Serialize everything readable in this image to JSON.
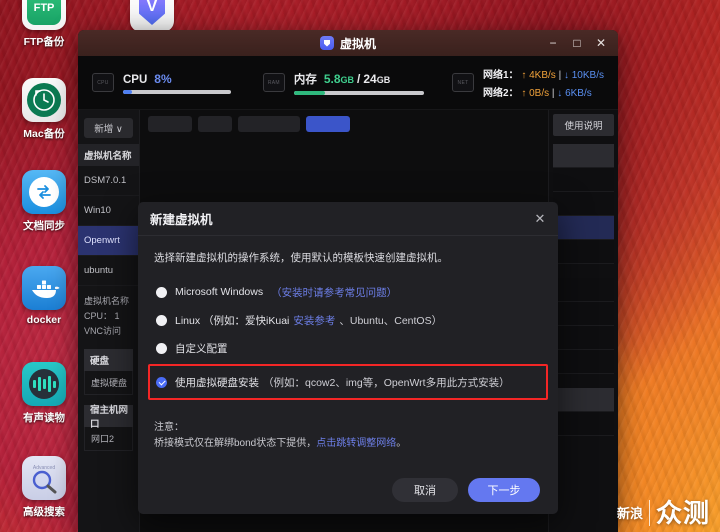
{
  "desktop": {
    "icons": [
      {
        "name": "ftp-backup",
        "label": "FTP备份",
        "glyph": "FTP",
        "style": "ic-ftp"
      },
      {
        "name": "mac-backup",
        "label": "Mac备份",
        "glyph": "clock",
        "style": "ic-tm"
      },
      {
        "name": "doc-sync",
        "label": "文档同步",
        "glyph": "sync",
        "style": "ic-sync"
      },
      {
        "name": "docker",
        "label": "docker",
        "glyph": "whale",
        "style": "ic-docker"
      },
      {
        "name": "audiobook",
        "label": "有声读物",
        "glyph": "waveform",
        "style": "ic-audio"
      },
      {
        "name": "advanced-search",
        "label": "高级搜索",
        "glyph": "magnifier",
        "style": "ic-search"
      },
      {
        "name": "virtual-machine",
        "label": "",
        "glyph": "V",
        "style": "ic-v"
      }
    ],
    "watermark": {
      "small": "新浪",
      "big": "众测"
    }
  },
  "window": {
    "title": "虚拟机",
    "logo_icon": "shield-icon",
    "controls": {
      "minimize": "−",
      "maximize": "□",
      "close": "✕"
    }
  },
  "stats": {
    "cpu": {
      "label": "CPU",
      "value": "8%",
      "percent": 8,
      "icon": "cpu-icon",
      "icon_text": "CPU"
    },
    "memory": {
      "label": "内存",
      "used": "5.8",
      "used_unit": "GB",
      "total": "24",
      "total_unit": "GB",
      "separator": "/",
      "percent": 24,
      "icon": "ram-icon",
      "icon_text": "RAM"
    },
    "network": {
      "icon": "nic-icon",
      "icon_text": "NET",
      "lines": [
        {
          "label": "网络1：",
          "up": "↑ 4KB/s",
          "sep": "|",
          "down": "↓ 10KB/s"
        },
        {
          "label": "网络2：",
          "up": "↑ 0B/s",
          "sep": "|",
          "down": "↓ 6KB/s"
        }
      ]
    }
  },
  "workspace": {
    "new_button": "新增 ∨",
    "list_header": "虚拟机名称",
    "vm_items": [
      {
        "label": "DSM7.0.1",
        "selected": false
      },
      {
        "label": "Win10",
        "selected": false
      },
      {
        "label": "Openwrt",
        "selected": true
      },
      {
        "label": "ubuntu",
        "selected": false
      }
    ],
    "info_lines": [
      "虚拟机名称",
      "CPU： 1",
      "VNC访问"
    ],
    "sections": [
      {
        "header": "硬盘",
        "row": "虚拟硬盘"
      },
      {
        "header": "宿主机网口",
        "row": "网口2"
      }
    ],
    "help_button": "使用说明"
  },
  "dialog": {
    "title": "新建虚拟机",
    "close_icon": "close-icon",
    "description": "选择新建虚拟机的操作系统，使用默认的模板快速创建虚拟机。",
    "options": [
      {
        "id": "windows",
        "label": "Microsoft Windows",
        "link": "（安装时请参考常见问题）",
        "selected": false,
        "highlighted": false
      },
      {
        "id": "linux",
        "label": "Linux （例如：爱快iKuai",
        "link": "安装参考",
        "tail": "、Ubuntu、CentOS）",
        "selected": false,
        "highlighted": false
      },
      {
        "id": "custom",
        "label": "自定义配置",
        "selected": false,
        "highlighted": false
      },
      {
        "id": "virtual-disk",
        "label": "使用虚拟硬盘安装",
        "tail": "（例如：qcow2、img等，OpenWrt多用此方式安装）",
        "selected": true,
        "highlighted": true
      }
    ],
    "notes": {
      "title": "注意：",
      "text_before": "桥接模式仅在解绑bond状态下提供，",
      "link": "点击跳转调整网络",
      "text_after": "。"
    },
    "buttons": {
      "cancel": "取消",
      "next": "下一步"
    }
  },
  "colors": {
    "accent_blue": "#6478f0",
    "cpu_blue": "#6b8cf0",
    "mem_green": "#3fcf8e",
    "highlight_red": "#f42626",
    "link_blue": "#6d7fe8"
  }
}
